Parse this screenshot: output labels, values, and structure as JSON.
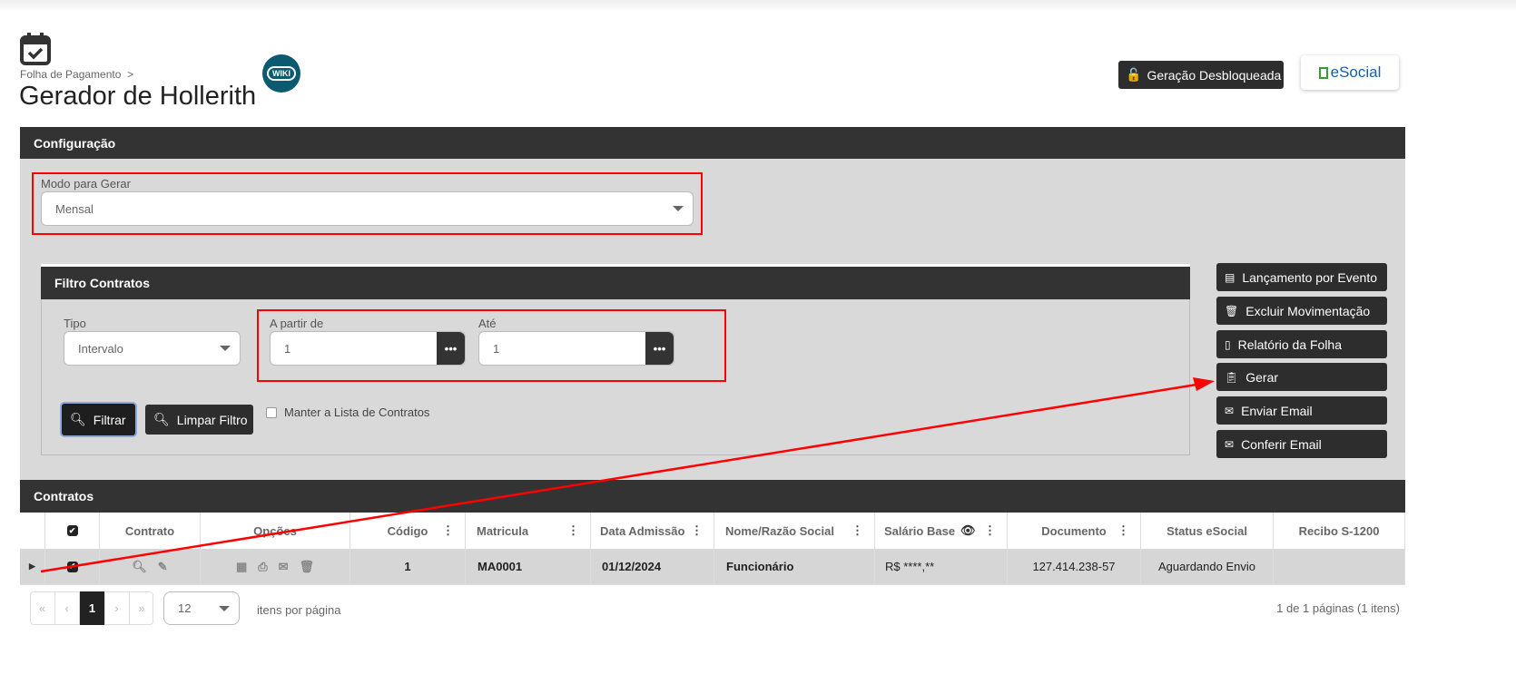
{
  "header": {
    "breadcrumb": "Folha de Pagamento",
    "breadcrumb_sep": ">",
    "title": "Gerador de Hollerith",
    "wiki": "WIKI",
    "generation_status": "Geração Desbloqueada",
    "esocial": "eSocial"
  },
  "config": {
    "title": "Configuração",
    "mode_label": "Modo para Gerar",
    "mode_value": "Mensal"
  },
  "filter": {
    "title": "Filtro Contratos",
    "type_label": "Tipo",
    "type_value": "Intervalo",
    "from_label": "A partir de",
    "from_value": "1",
    "to_label": "Até",
    "to_value": "1",
    "dots": "•••",
    "filter_btn": "Filtrar",
    "clear_btn": "Limpar Filtro",
    "keep_list": "Manter a Lista de Contratos",
    "keep_list_checked": false
  },
  "actions": [
    "Lançamento por Evento",
    "Excluir Movimentação",
    "Relatório da Folha",
    "Gerar",
    "Enviar Email",
    "Conferir Email"
  ],
  "contracts": {
    "title": "Contratos",
    "columns": [
      "Contrato",
      "Opções",
      "Código",
      "Matricula",
      "Data Admissão",
      "Nome/Razão Social",
      "Salário Base",
      "Documento",
      "Status eSocial",
      "Recibo S-1200"
    ],
    "rows": [
      {
        "codigo": "1",
        "matricula": "MA0001",
        "admissao": "01/12/2024",
        "nome": "Funcionário",
        "salario": "R$ ****,**",
        "documento": "127.414.238-57",
        "status": "Aguardando Envio",
        "recibo": ""
      }
    ]
  },
  "pagination": {
    "first": "«",
    "prev": "‹",
    "current": "1",
    "next": "›",
    "last": "»",
    "page_size": "12",
    "per_page_label": "itens por página",
    "summary": "1 de 1 páginas (1 itens)"
  },
  "colors": {
    "dark": "#333333",
    "panel": "#d9d9d9",
    "annotation": "#ff0000",
    "wiki": "#0b5a70"
  }
}
